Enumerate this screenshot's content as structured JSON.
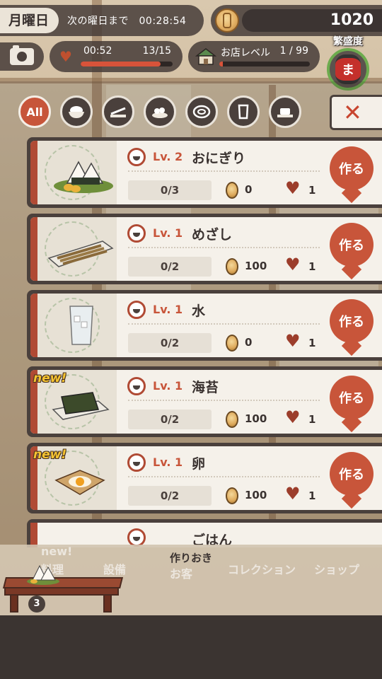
{
  "hud": {
    "day_name": "月曜日",
    "day_countdown": "次の曜日まで　00:28:54",
    "coins": "1020",
    "stamina_time": "00:52",
    "stamina_count": "13/15",
    "stamina_fraction": 0.867,
    "shop_level_label": "お店レベル",
    "shop_level_value": "1 / 99",
    "shop_level_fraction": 0.01,
    "prosperity_label": "繁盛度",
    "lantern_char": "ま"
  },
  "tabs": [
    {
      "label": "All",
      "icon": "all-icon"
    },
    {
      "label": "",
      "icon": "rice-bowl-icon"
    },
    {
      "label": "",
      "icon": "grill-icon"
    },
    {
      "label": "",
      "icon": "side-dish-icon"
    },
    {
      "label": "",
      "icon": "soup-bowl-icon"
    },
    {
      "label": "",
      "icon": "drink-glass-icon"
    },
    {
      "label": "",
      "icon": "dessert-icon"
    }
  ],
  "close_label": "✕",
  "recipes": [
    {
      "lv": "Lv. 2",
      "name": "おにぎり",
      "progress": "0/3",
      "coin": "0",
      "heart": "1",
      "make": "作る",
      "new": ""
    },
    {
      "lv": "Lv. 1",
      "name": "めざし",
      "progress": "0/2",
      "coin": "100",
      "heart": "1",
      "make": "作る",
      "new": ""
    },
    {
      "lv": "Lv. 1",
      "name": "水",
      "progress": "0/2",
      "coin": "0",
      "heart": "1",
      "make": "作る",
      "new": ""
    },
    {
      "lv": "Lv. 1",
      "name": "海苔",
      "progress": "0/2",
      "coin": "100",
      "heart": "1",
      "make": "作る",
      "new": "new!"
    },
    {
      "lv": "Lv. 1",
      "name": "卵",
      "progress": "0/2",
      "coin": "100",
      "heart": "1",
      "make": "作る",
      "new": "new!"
    }
  ],
  "peek_name": "ごはん",
  "bottom": {
    "stock_title": "作りおき",
    "stock_count": "3",
    "ghost_nav": [
      "料理",
      "設備",
      "お客",
      "コレクション",
      "ショップ"
    ],
    "ghost_new": "new!"
  },
  "colors": {
    "accent": "#c8553a",
    "panel_dark": "#4a403c",
    "card_bg": "#f5f1ea",
    "gauge_green": "#6dab4e"
  }
}
